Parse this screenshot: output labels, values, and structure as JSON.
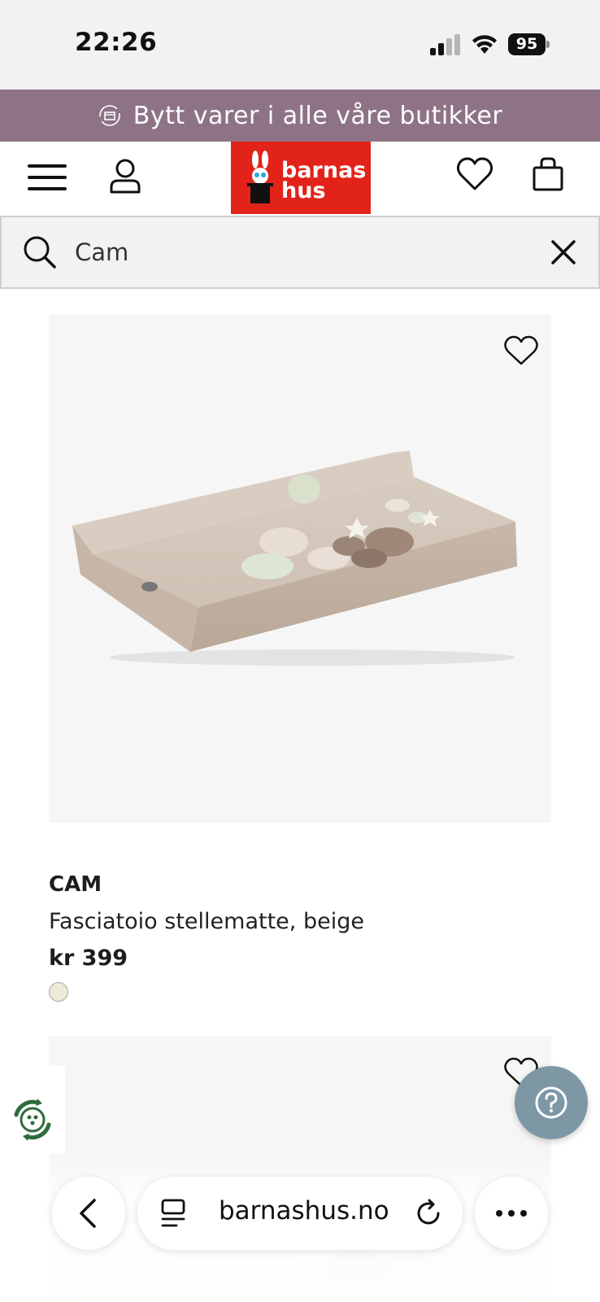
{
  "status_bar": {
    "time": "22:26",
    "battery": "95"
  },
  "promo": {
    "text": "Bytt varer i alle våre butikker",
    "icon": "exchange-box-icon"
  },
  "header": {
    "logo_line1": "barnas",
    "logo_line2": "hus",
    "menu_icon": "hamburger-menu-icon",
    "account_icon": "user-icon",
    "wishlist_icon": "heart-icon",
    "bag_icon": "shopping-bag-icon"
  },
  "search": {
    "value": "Cam",
    "search_icon": "search-icon",
    "clear_icon": "close-icon"
  },
  "products": [
    {
      "brand": "CAM",
      "name": "Fasciatoio stellematte, beige",
      "price": "kr 399",
      "swatch_color": "#ecebd8"
    }
  ],
  "colors": {
    "promo_bg": "#8e7386",
    "logo_red": "#e2231a",
    "help_button": "#7d97a5"
  },
  "browser": {
    "url": "barnashus.no",
    "back_icon": "chevron-left-icon",
    "reader_icon": "reader-mode-icon",
    "reload_icon": "reload-icon",
    "more_icon": "more-dots-icon"
  },
  "floating": {
    "help_icon": "question-mark-icon",
    "eco_icon": "recycle-badge-icon"
  }
}
